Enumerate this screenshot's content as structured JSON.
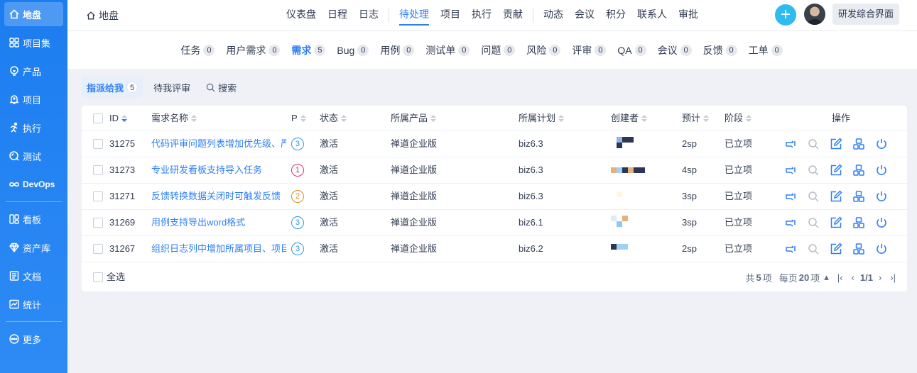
{
  "sidebar": {
    "items": [
      {
        "label": "地盘",
        "icon": "home-icon"
      },
      {
        "label": "项目集",
        "icon": "grid-icon"
      },
      {
        "label": "产品",
        "icon": "lightbulb-icon"
      },
      {
        "label": "项目",
        "icon": "bell-icon"
      },
      {
        "label": "执行",
        "icon": "running-icon"
      },
      {
        "label": "测试",
        "icon": "search-bug-icon"
      },
      {
        "label": "DevOps",
        "icon": "infinity-icon"
      },
      {
        "label": "看板",
        "icon": "kanban-icon"
      },
      {
        "label": "资产库",
        "icon": "diamond-icon"
      },
      {
        "label": "文档",
        "icon": "document-icon"
      },
      {
        "label": "统计",
        "icon": "chart-icon"
      },
      {
        "label": "更多",
        "icon": "more-icon"
      }
    ]
  },
  "header": {
    "breadcrumb": "地盘",
    "nav": [
      "仪表盘",
      "日程",
      "日志",
      "待处理",
      "项目",
      "执行",
      "贡献",
      "动态",
      "会议",
      "积分",
      "联系人",
      "审批"
    ],
    "active_nav": "待处理",
    "plus": "+",
    "mode_button": "研发综合界面"
  },
  "subnav": [
    {
      "label": "任务",
      "count": "0"
    },
    {
      "label": "用户需求",
      "count": "0"
    },
    {
      "label": "需求",
      "count": "5"
    },
    {
      "label": "Bug",
      "count": "0"
    },
    {
      "label": "用例",
      "count": "0"
    },
    {
      "label": "测试单",
      "count": "0"
    },
    {
      "label": "问题",
      "count": "0"
    },
    {
      "label": "风险",
      "count": "0"
    },
    {
      "label": "评审",
      "count": "0"
    },
    {
      "label": "QA",
      "count": "0"
    },
    {
      "label": "会议",
      "count": "0"
    },
    {
      "label": "反馈",
      "count": "0"
    },
    {
      "label": "工单",
      "count": "0"
    }
  ],
  "filters": {
    "assigned": {
      "label": "指派给我",
      "count": "5"
    },
    "review": "待我评审",
    "search": "搜索"
  },
  "table": {
    "headers": {
      "id": "ID",
      "name": "需求名称",
      "pri": "P",
      "status": "状态",
      "product": "所属产品",
      "plan": "所属计划",
      "creator": "创建者",
      "estimate": "预计",
      "stage": "阶段",
      "actions": "操作"
    },
    "rows": [
      {
        "id": "31275",
        "name": "代码评审问题列表增加优先级、严",
        "pri": "3",
        "pri_color": "#2e9ae6",
        "status": "激活",
        "product": "禅道企业版",
        "plan": "biz6.3",
        "estimate": "2sp",
        "stage": "已立项",
        "creator_colors": [
          "#ffffff",
          "#8fb6e3",
          "#2c3554",
          "#2c3554",
          "#ffffff",
          "#2c3554",
          "#ffffff",
          "#ffffff"
        ]
      },
      {
        "id": "31273",
        "name": "专业研发看板支持导入任务",
        "pri": "1",
        "pri_color": "#d6336c",
        "status": "激活",
        "product": "禅道企业版",
        "plan": "biz6.3",
        "estimate": "4sp",
        "stage": "已立项",
        "creator_colors": [
          "#e6b07a",
          "#9fd0f5",
          "#2c3554",
          "#e6b07a",
          "#2c3554",
          "#2c3554"
        ]
      },
      {
        "id": "31271",
        "name": "反馈转换数据关闭时可触发反馈",
        "pri": "2",
        "pri_color": "#e08a1e",
        "status": "激活",
        "product": "禅道企业版",
        "plan": "biz6.3",
        "estimate": "3sp",
        "stage": "已立项",
        "creator_colors": [
          "#ffffff",
          "#fff6dc",
          "#ffffff"
        ]
      },
      {
        "id": "31269",
        "name": "用例支持导出word格式",
        "pri": "3",
        "pri_color": "#2e9ae6",
        "status": "激活",
        "product": "禅道企业版",
        "plan": "biz6.1",
        "estimate": "3sp",
        "stage": "已立项",
        "creator_colors": [
          "#d8ecfb",
          "#ffffff",
          "#e6b07a",
          "#ffffff",
          "#8fc9f2",
          "#ffffff"
        ]
      },
      {
        "id": "31267",
        "name": "组织日志列中增加所属项目、项目",
        "pri": "3",
        "pri_color": "#2e9ae6",
        "status": "激活",
        "product": "禅道企业版",
        "plan": "biz6.2",
        "estimate": "2sp",
        "stage": "已立项",
        "creator_colors": [
          "#2c3554",
          "#9fd0f5",
          "#9fd0f5"
        ]
      }
    ]
  },
  "footer": {
    "select_all": "全选",
    "total_prefix": "共",
    "total": "5",
    "total_suffix": "项",
    "per_page_prefix": "每页",
    "per_page": "20",
    "per_page_suffix": "项",
    "page": "1/1"
  }
}
